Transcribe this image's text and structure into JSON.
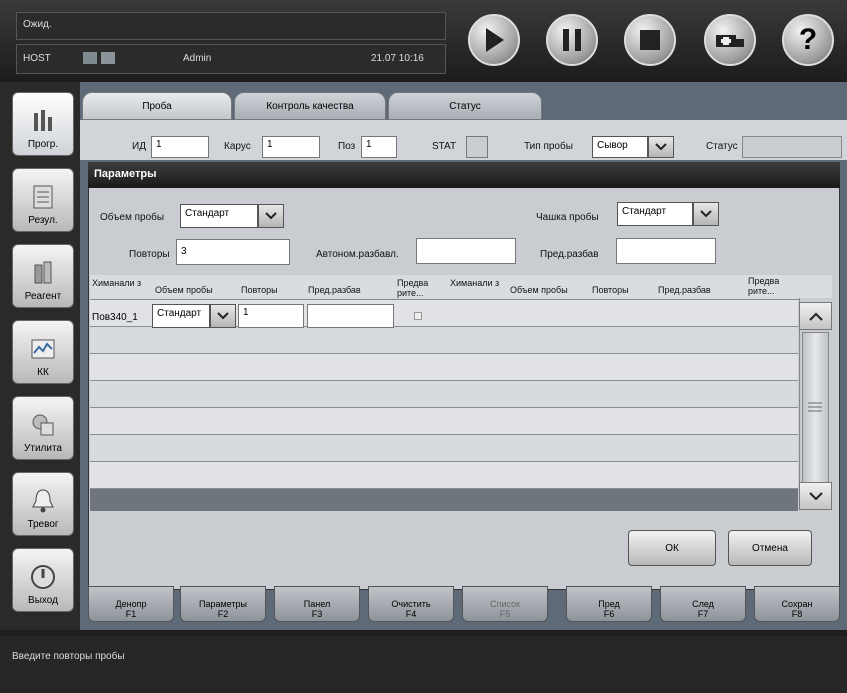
{
  "topbar": {
    "state": "Ожид.",
    "host": "HOST",
    "user": "Admin",
    "datetime": "21.07 10:16",
    "buttons": [
      {
        "name": "play-icon"
      },
      {
        "name": "pause-icon"
      },
      {
        "name": "stop-icon"
      },
      {
        "name": "ambulance-icon"
      },
      {
        "name": "help-icon",
        "label": "?"
      }
    ]
  },
  "nav": {
    "items": [
      {
        "label": "Прогр.",
        "icon": "bar-chart-icon"
      },
      {
        "label": "Резул.",
        "icon": "results-icon"
      },
      {
        "label": "Реагент",
        "icon": "reagent-icon"
      },
      {
        "label": "КК",
        "icon": "qc-chart-icon"
      },
      {
        "label": "Утилита",
        "icon": "utility-icon"
      },
      {
        "label": "Тревог",
        "icon": "bell-icon"
      },
      {
        "label": "Выход",
        "icon": "exit-icon"
      }
    ]
  },
  "tabs": [
    "Проба",
    "Контроль качества",
    "Статус"
  ],
  "sample": {
    "id_label": "ИД",
    "id_value": "1",
    "carousel_label": "Карус",
    "carousel_value": "1",
    "pos_label": "Поз",
    "pos_value": "1",
    "stat_label": "STAT",
    "type_label": "Тип пробы",
    "type_value": "Сывор",
    "status_label": "Статус"
  },
  "dialog": {
    "title": "Параметры",
    "volume_label": "Объем пробы",
    "volume_value": "Стандарт",
    "cup_label": "Чашка пробы",
    "cup_value": "Стандарт",
    "repeats_label": "Повторы",
    "repeats_value": "3",
    "autodil_label": "Автоном.разбавл.",
    "autodil_value": "",
    "predil_label": "Пред.разбав",
    "predil_value": "",
    "grid_headers": [
      "Химанали з",
      "Объем пробы",
      "Повторы",
      "Пред.разбав",
      "Предва рите...",
      "Химанали з",
      "Объем пробы",
      "Повторы",
      "Пред.разбав",
      "Предва рите..."
    ],
    "row1": {
      "analyte": "Пов340_1",
      "volume": "Стандарт",
      "repeats": "1",
      "predil": ""
    },
    "ok": "ОК",
    "cancel": "Отмена"
  },
  "fkeys": [
    {
      "label": "Денопр",
      "key": "F1"
    },
    {
      "label": "Параметры",
      "key": "F2"
    },
    {
      "label": "Панел",
      "key": "F3"
    },
    {
      "label": "Очистить",
      "key": "F4"
    },
    {
      "label": "Список",
      "key": "F5"
    },
    {
      "label": "Пред",
      "key": "F6"
    },
    {
      "label": "След",
      "key": "F7"
    },
    {
      "label": "Сохран",
      "key": "F8"
    }
  ],
  "status_message": "Введите повторы пробы",
  "colors": {
    "main_bg": "#5e6a78",
    "dialog_bg": "#c9cdd2",
    "title_bar": "#1a1a1a"
  }
}
